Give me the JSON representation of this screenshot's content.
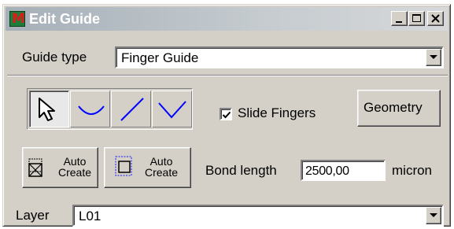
{
  "window": {
    "title": "Edit Guide",
    "icon": "app-logo-icon"
  },
  "guide_type": {
    "label": "Guide type",
    "value": "Finger Guide"
  },
  "tools": [
    {
      "name": "select-arrow-icon",
      "selected": true
    },
    {
      "name": "arc-icon",
      "selected": false
    },
    {
      "name": "line-icon",
      "selected": false
    },
    {
      "name": "v-shape-icon",
      "selected": false
    }
  ],
  "slide_fingers": {
    "label": "Slide Fingers",
    "checked": true
  },
  "geometry_button": "Geometry",
  "auto_create_1": {
    "line1": "Auto",
    "line2": "Create"
  },
  "auto_create_2": {
    "line1": "Auto",
    "line2": "Create"
  },
  "bond_length": {
    "label": "Bond length",
    "value": "2500,00",
    "unit": "micron"
  },
  "layer": {
    "label": "Layer",
    "value": "L01"
  }
}
